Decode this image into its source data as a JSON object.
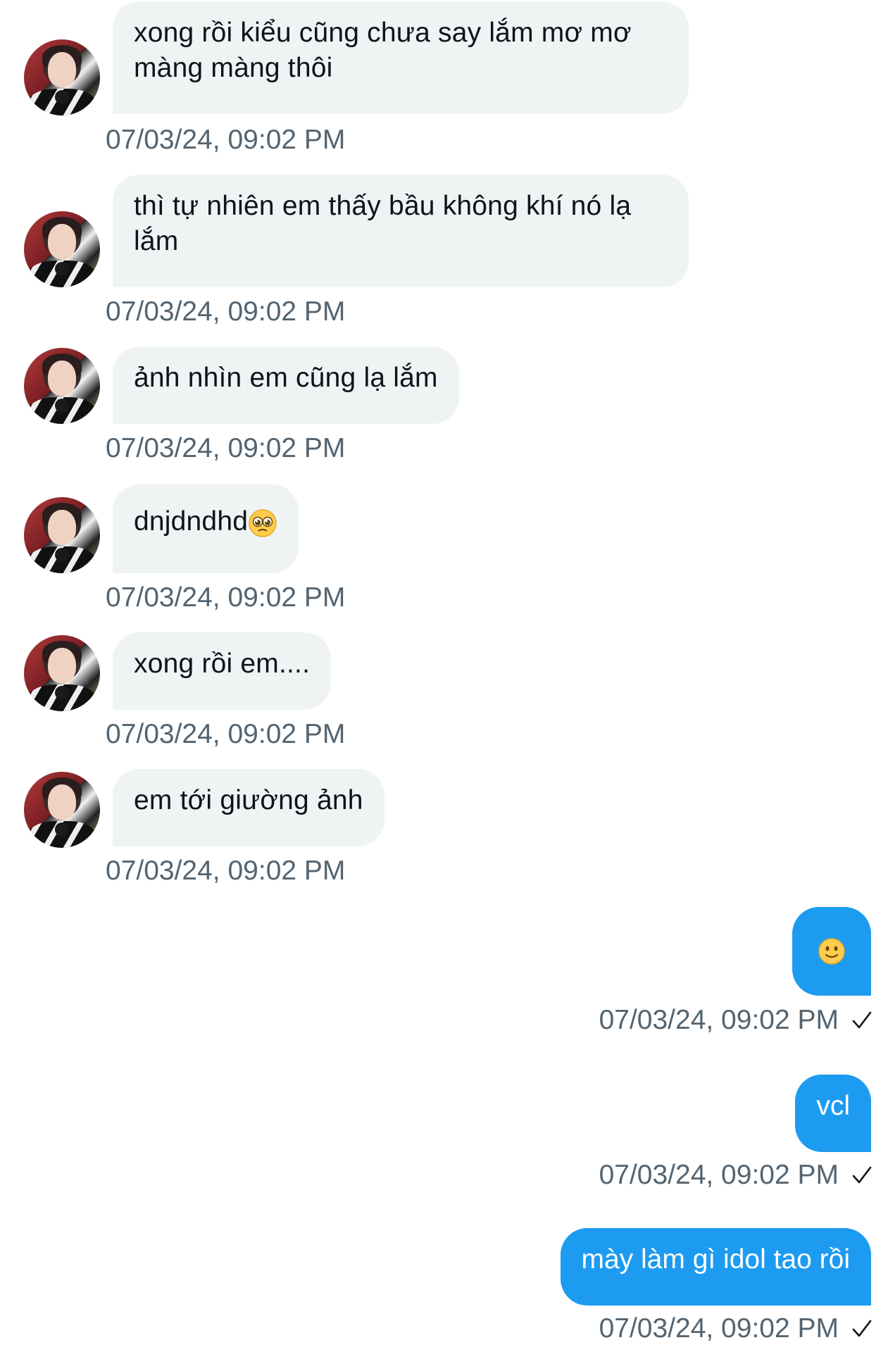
{
  "conversation": {
    "incoming": [
      {
        "text": "xong rồi kiểu cũng chưa say lắm mơ mơ màng màng thôi",
        "timestamp": "07/03/24, 09:02 PM"
      },
      {
        "text": "thì tự nhiên em thấy bầu không khí nó lạ lắm",
        "timestamp": "07/03/24, 09:02 PM"
      },
      {
        "text": "ảnh nhìn em cũng lạ lắm",
        "timestamp": "07/03/24, 09:02 PM"
      },
      {
        "text": "dnjdndhd",
        "emoji": "pleading-face",
        "timestamp": "07/03/24, 09:02 PM"
      },
      {
        "text": "xong rồi em....",
        "timestamp": "07/03/24, 09:02 PM"
      },
      {
        "text": "em tới giường ảnh",
        "timestamp": "07/03/24, 09:02 PM"
      }
    ],
    "outgoing": [
      {
        "emoji": "slightly-smiling-face",
        "timestamp": "07/03/24, 09:02 PM",
        "status_icon": "check-icon"
      },
      {
        "text": "vcl",
        "timestamp": "07/03/24, 09:02 PM",
        "status_icon": "check-icon"
      },
      {
        "text": "mày làm gì idol tao rồi",
        "timestamp": "07/03/24, 09:02 PM",
        "status_icon": "check-icon"
      }
    ]
  },
  "colors": {
    "incoming_bubble": "#eff3f4",
    "outgoing_bubble": "#1d9bf0",
    "timestamp": "#536471",
    "text": "#0f1419"
  }
}
